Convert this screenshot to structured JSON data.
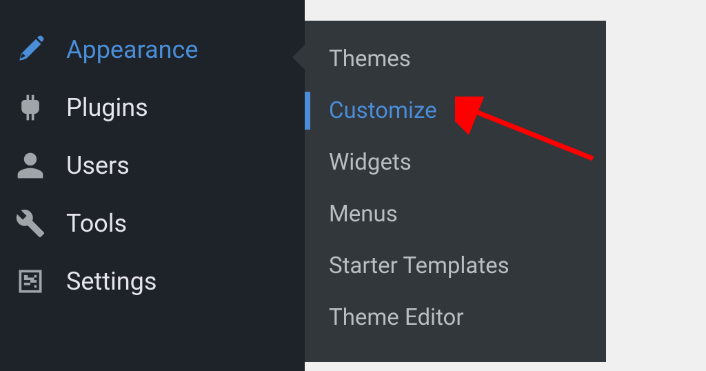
{
  "sidebar": {
    "items": [
      {
        "label": "Appearance"
      },
      {
        "label": "Plugins"
      },
      {
        "label": "Users"
      },
      {
        "label": "Tools"
      },
      {
        "label": "Settings"
      }
    ]
  },
  "submenu": {
    "items": [
      {
        "label": "Themes"
      },
      {
        "label": "Customize"
      },
      {
        "label": "Widgets"
      },
      {
        "label": "Menus"
      },
      {
        "label": "Starter Templates"
      },
      {
        "label": "Theme Editor"
      }
    ]
  }
}
